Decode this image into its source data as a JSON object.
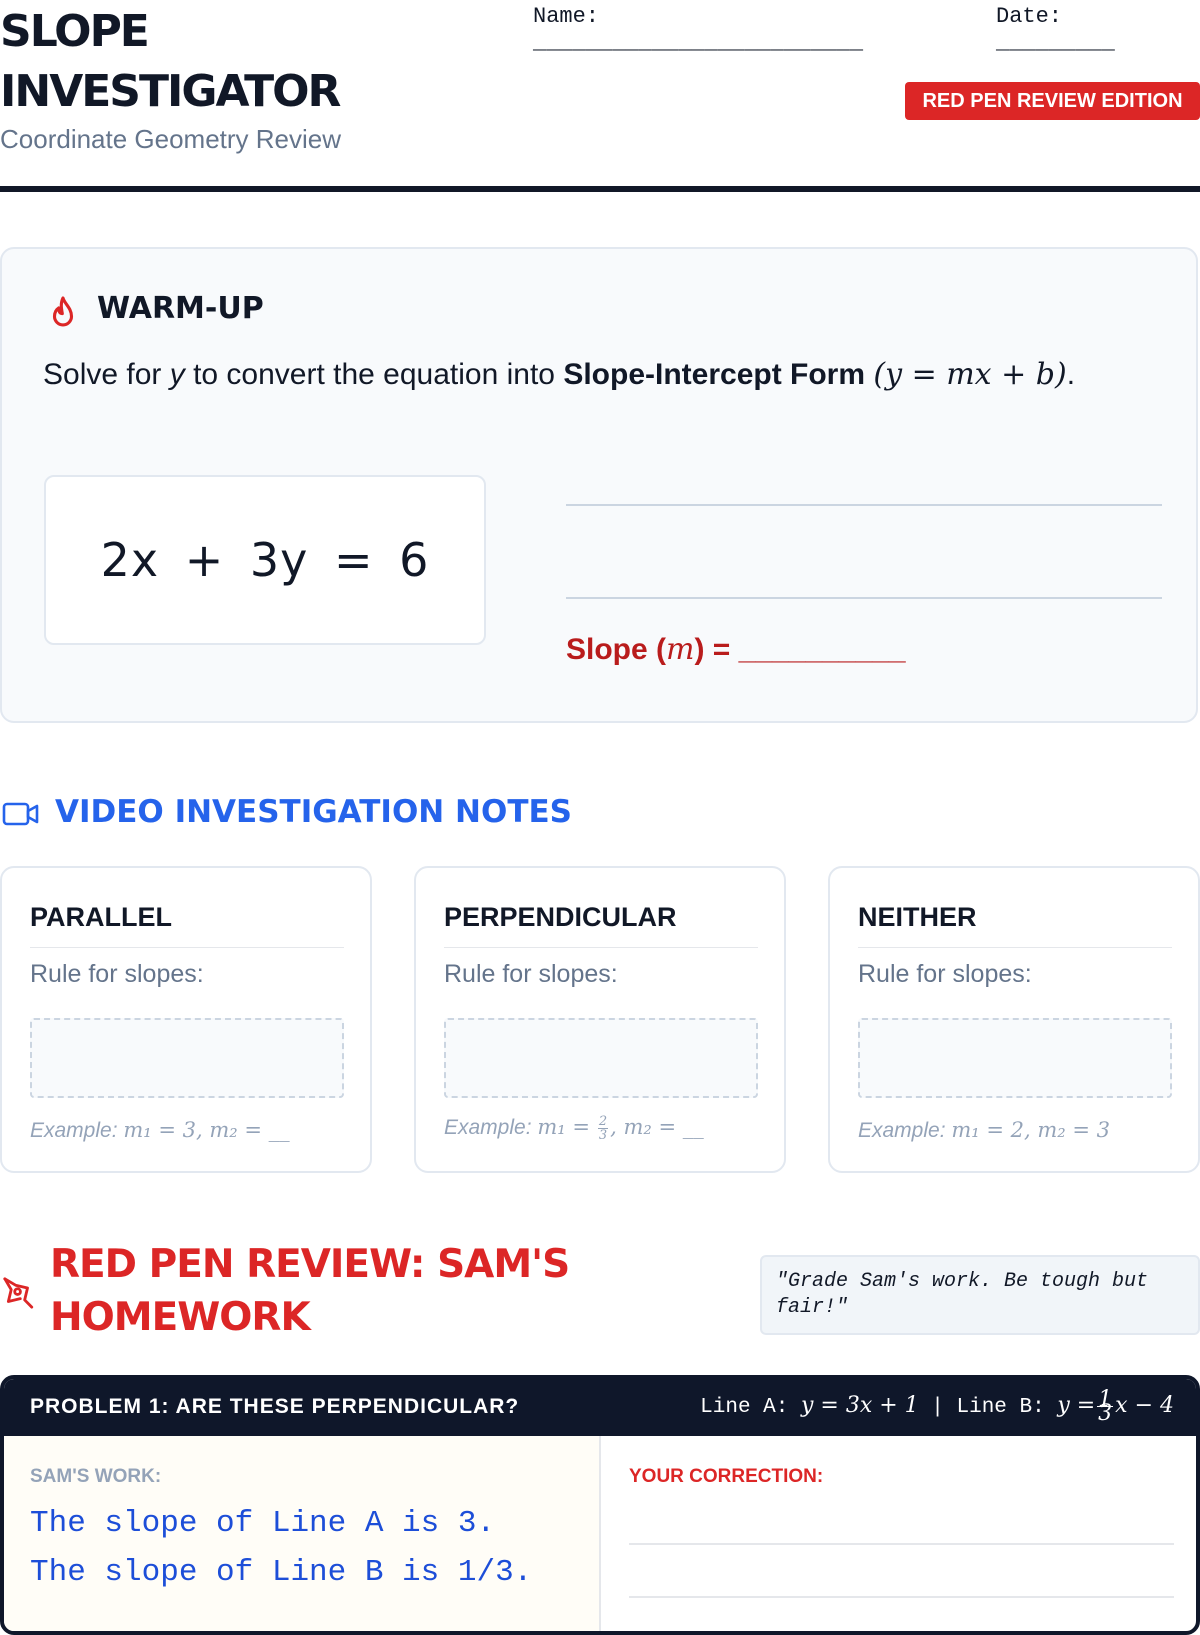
{
  "header": {
    "title_line1": "SLOPE",
    "title_line2": "INVESTIGATOR",
    "subtitle": "Coordinate Geometry Review",
    "name_label": "Name:",
    "name_line": "_________________________",
    "date_label": "Date:",
    "date_line": "_________",
    "edition_badge": "RED PEN REVIEW EDITION"
  },
  "warmup": {
    "icon": "flame-icon",
    "heading": "WARM-UP",
    "instruction_pre": "Solve for ",
    "instruction_var": "y",
    "instruction_mid": " to convert the equation into ",
    "instruction_bold": "Slope-Intercept Form",
    "instruction_formula": "(y = mx + b)",
    "instruction_end": ".",
    "equation": "2x + 3y = 6",
    "slope_prefix": "Slope (",
    "slope_var": "m",
    "slope_suffix": ") = ",
    "slope_blank": "__________"
  },
  "video": {
    "icon": "video-icon",
    "heading": "VIDEO INVESTIGATION NOTES",
    "cards": [
      {
        "title": "PARALLEL",
        "rule_label": "Rule for slopes:",
        "example_label": "Example:",
        "example_math": "m₁ = 3, m₂ = __"
      },
      {
        "title": "PERPENDICULAR",
        "rule_label": "Rule for slopes:",
        "example_label": "Example:",
        "example_pre": "m₁ =",
        "example_frac_num": "2",
        "example_frac_den": "3",
        "example_post": ", m₂ = __"
      },
      {
        "title": "NEITHER",
        "rule_label": "Rule for slopes:",
        "example_label": "Example:",
        "example_math": "m₁ = 2, m₂ = 3"
      }
    ]
  },
  "red_pen": {
    "icon": "pen-icon",
    "heading": "RED PEN REVIEW: SAM'S HOMEWORK",
    "quote": "\"Grade Sam's work. Be tough but fair!\"",
    "problem1": {
      "title": "PROBLEM 1: ARE THESE PERPENDICULAR?",
      "line_a_label": "Line A:",
      "line_a_eq": "y = 3x + 1",
      "separator": "|",
      "line_b_label": "Line B:",
      "line_b_pre": "y =",
      "line_b_frac_num": "1",
      "line_b_frac_den": "3",
      "line_b_post": "x − 4",
      "work_label": "SAM'S WORK:",
      "work_lines": [
        "The slope of Line A is 3.",
        "The slope of Line B is 1/3."
      ],
      "correction_label": "YOUR CORRECTION:"
    }
  },
  "colors": {
    "accent_red": "#dc2626",
    "accent_blue": "#2563eb",
    "ink": "#0f172a"
  }
}
